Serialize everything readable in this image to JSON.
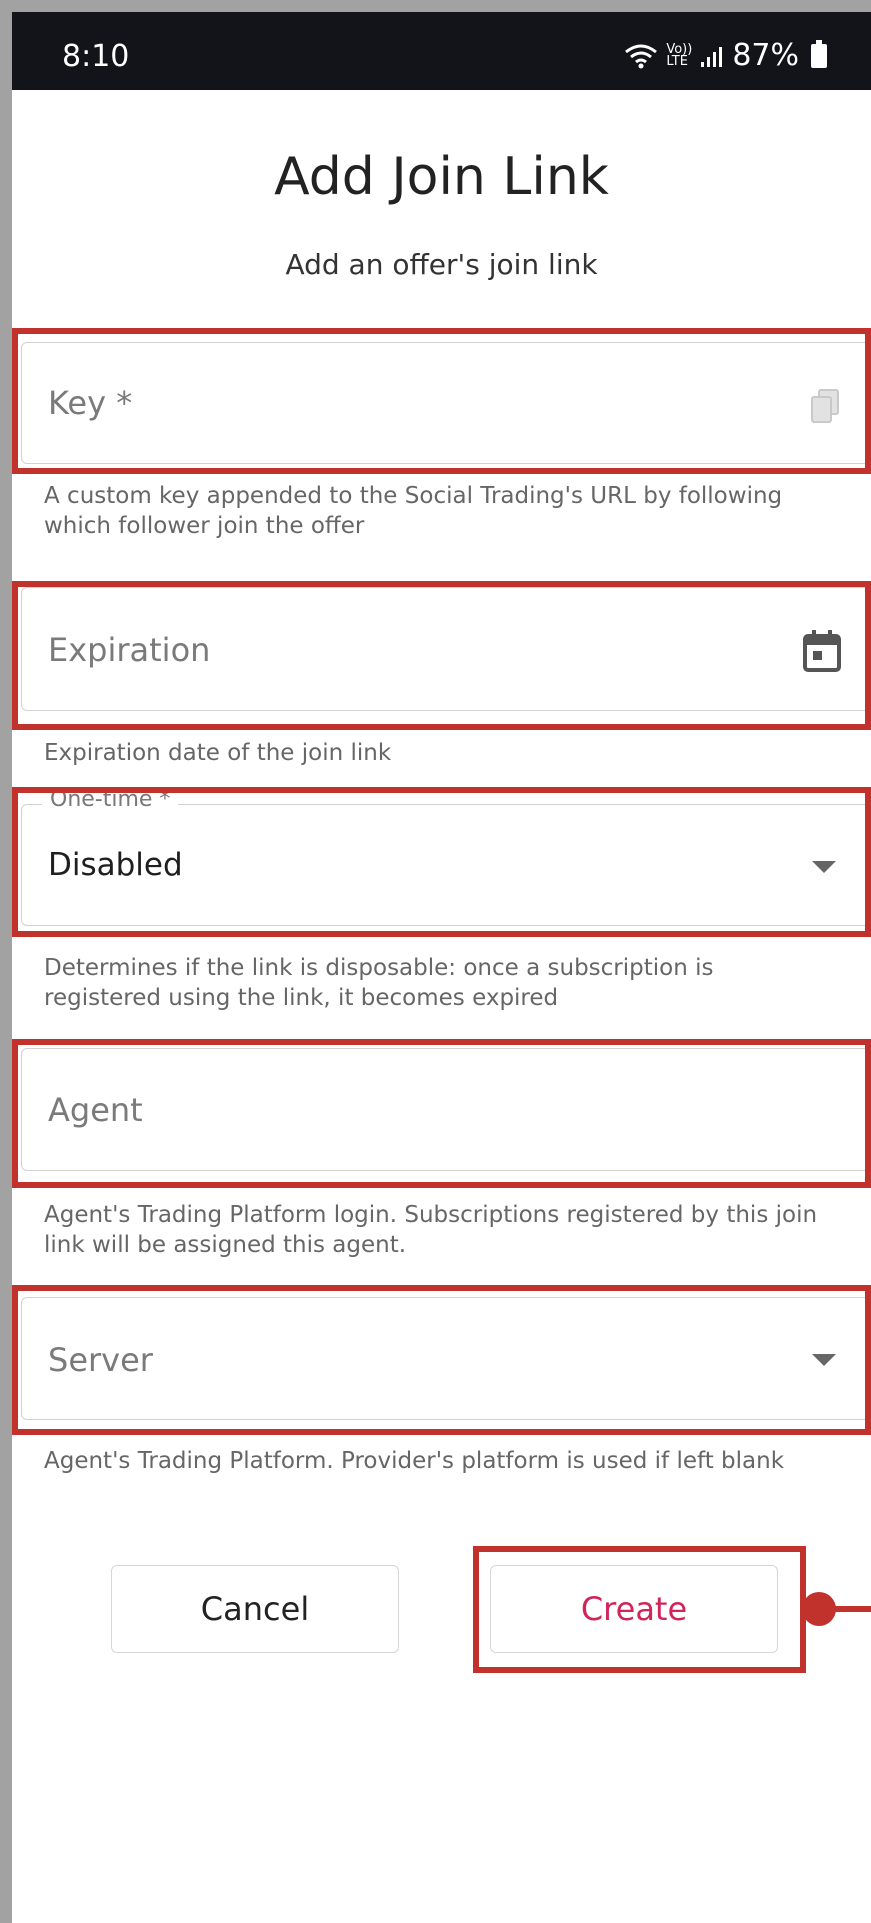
{
  "status_bar": {
    "time": "8:10",
    "network_top": "Vo))",
    "network_bottom": "LTE",
    "battery": "87%"
  },
  "dialog": {
    "title": "Add Join Link",
    "subtitle": "Add an offer's join link"
  },
  "fields": {
    "key": {
      "placeholder": "Key *",
      "icon": "copy-icon",
      "helper": "A custom key appended to the Social Trading's URL by following which follower join the offer"
    },
    "expiration": {
      "placeholder": "Expiration",
      "icon": "calendar-icon",
      "helper": "Expiration date of the join link"
    },
    "one_time": {
      "label": "One-time *",
      "value": "Disabled",
      "icon": "chevron-down-icon",
      "helper": "Determines if the link is disposable: once a subscription is registered using the link, it becomes expired"
    },
    "agent": {
      "placeholder": "Agent",
      "helper": "Agent's Trading Platform login. Subscriptions registered by this join link will be assigned this agent."
    },
    "server": {
      "placeholder": "Server",
      "icon": "chevron-down-icon",
      "helper": "Agent's Trading Platform. Provider's platform is used if left blank"
    }
  },
  "buttons": {
    "cancel": "Cancel",
    "create": "Create"
  },
  "colors": {
    "highlight": "#c1322d",
    "create_text": "#d1255a",
    "status_bar": "#13131a"
  }
}
